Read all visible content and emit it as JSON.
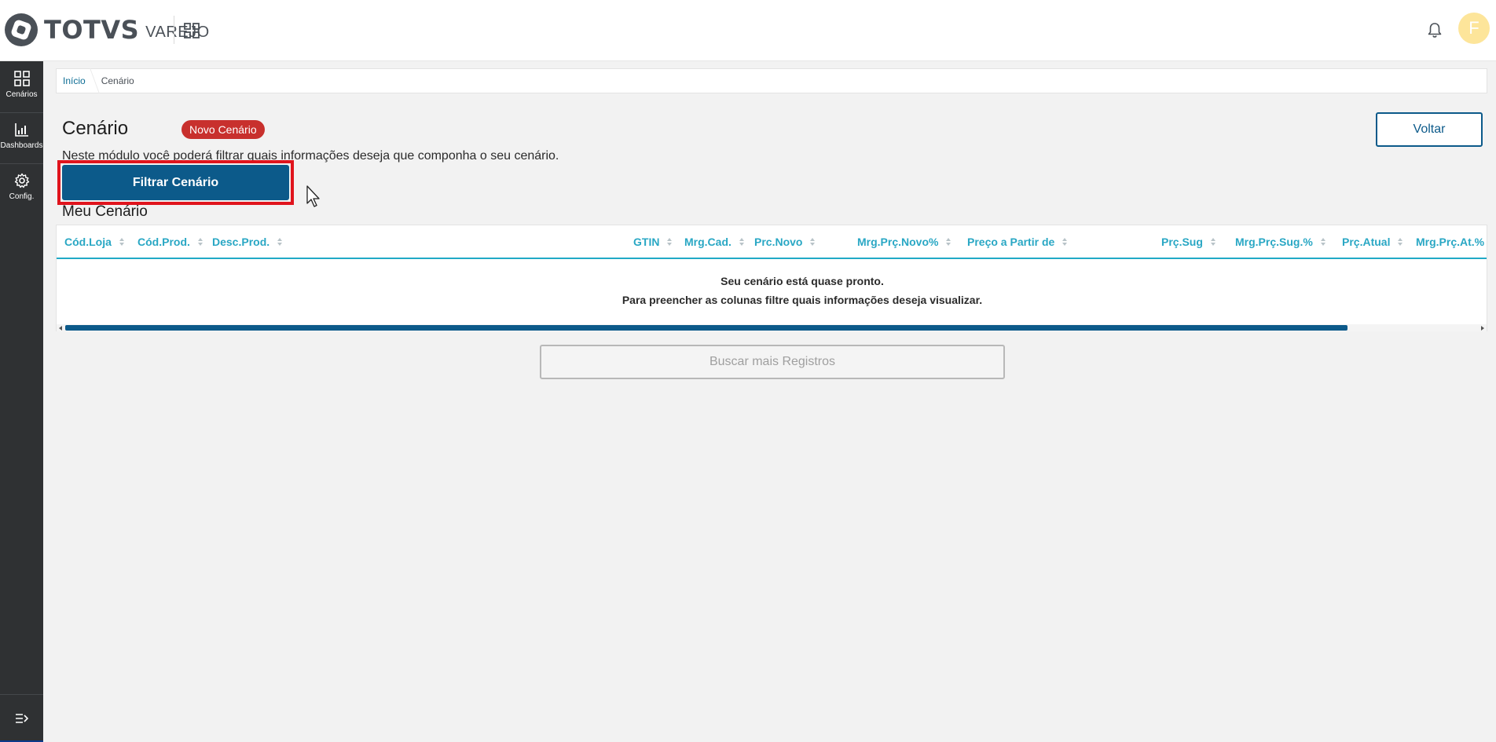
{
  "header": {
    "logo_text": "TOTVS",
    "logo_sub": "VAREJO",
    "avatar_initial": "F"
  },
  "sidebar": {
    "items": [
      {
        "label": "Cenários",
        "icon": "grid-icon"
      },
      {
        "label": "Dashboards",
        "icon": "bar-chart-icon"
      },
      {
        "label": "Config.",
        "icon": "gear-icon"
      }
    ],
    "collapse_icon": "menu-collapse-icon"
  },
  "breadcrumb": {
    "home": "Início",
    "current": "Cenário"
  },
  "page": {
    "title": "Cenário",
    "badge": "Novo Cenário",
    "description": "Neste módulo você poderá filtrar quais informações deseja que componha o seu cenário.",
    "back_label": "Voltar",
    "filter_label": "Filtrar Cenário",
    "section_title": "Meu Cenário"
  },
  "table": {
    "columns": [
      "Cód.Loja",
      "Cód.Prod.",
      "Desc.Prod.",
      "GTIN",
      "Mrg.Cad.",
      "Prc.Novo",
      "Mrg.Prç.Novo%",
      "Preço a Partir de",
      "Prç.Sug",
      "Mrg.Prç.Sug.%",
      "Prç.Atual",
      "Mrg.Prç.At.%"
    ],
    "empty_line1": "Seu cenário está quase pronto.",
    "empty_line2": "Para preencher as colunas filtre quais informações deseja visualizar."
  },
  "footer": {
    "more_label": "Buscar mais Registros"
  },
  "colors": {
    "primary": "#0c5a8a",
    "badge": "#c8302d",
    "highlight": "#e0141d",
    "column_header": "#29a7c4",
    "sidebar": "#2f3133"
  }
}
